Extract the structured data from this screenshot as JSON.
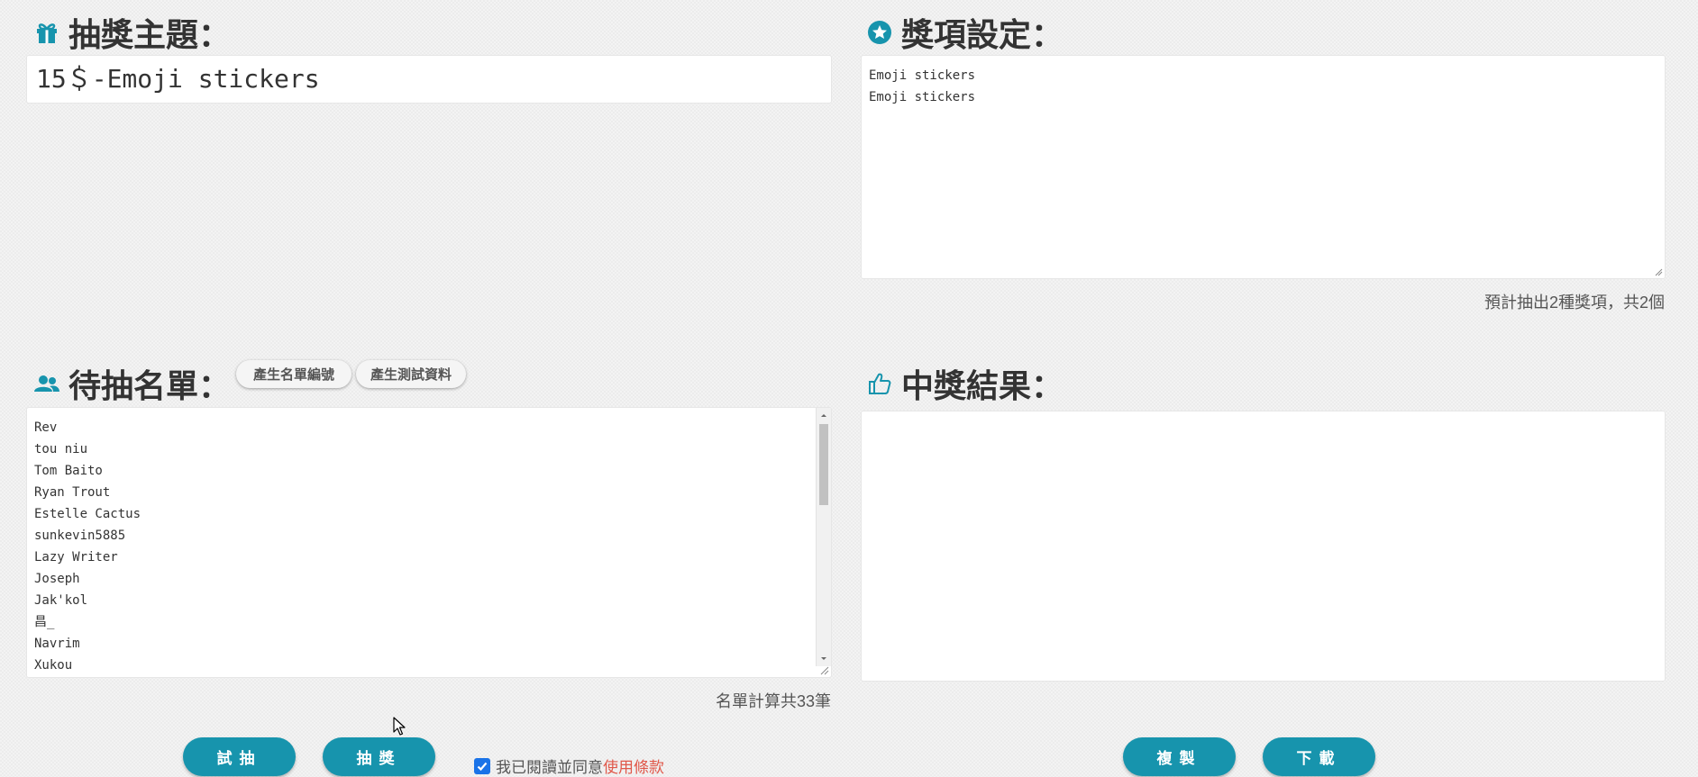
{
  "topic": {
    "heading": "抽獎主題：",
    "icon": "gift-icon",
    "value": "15＄-Emoji stickers"
  },
  "prizes": {
    "heading": "獎項設定：",
    "icon": "star-circle-icon",
    "lines": [
      "Emoji stickers",
      "Emoji stickers"
    ],
    "summary": "預計抽出2種獎項，共2個"
  },
  "names": {
    "heading": "待抽名單：",
    "icon": "users-icon",
    "generate_numbers_label": "產生名單編號",
    "generate_test_label": "產生測試資料",
    "list": [
      "Rev",
      "tou niu",
      "Tom Baito",
      "Ryan Trout",
      "Estelle Cactus",
      "sunkevin5885",
      "Lazy Writer",
      "Joseph",
      "Jak'kol",
      "昌_",
      "Navrim",
      "Xukou"
    ],
    "count_text": "名單計算共33筆"
  },
  "results": {
    "heading": "中獎結果：",
    "icon": "thumbs-up-icon"
  },
  "actions": {
    "trial_label": "試抽",
    "draw_label": "抽獎",
    "copy_label": "複製",
    "download_label": "下載",
    "terms_prefix": "我已閱讀並同意",
    "terms_link": "使用條款",
    "terms_checked": true
  },
  "colors": {
    "accent": "#1794ad",
    "link": "#e0584a",
    "checkbox": "#1a73e8"
  }
}
